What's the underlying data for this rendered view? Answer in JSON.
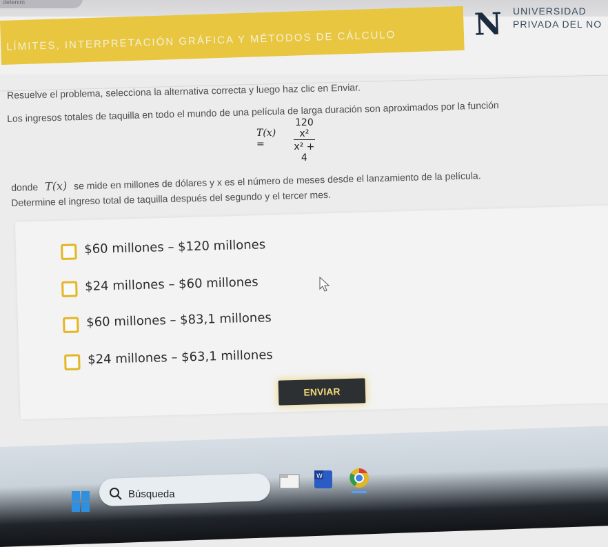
{
  "top_tab": {
    "label": "detenim"
  },
  "header": {
    "title": "LÍMITES, INTERPRETACIÓN GRÁFICA Y MÉTODOS DE CÁLCULO",
    "logo_letter": "N",
    "logo_line1": "UNIVERSIDAD",
    "logo_line2": "PRIVADA DEL NO"
  },
  "problem": {
    "instruction": "Resuelve el problema, selecciona la alternativa correcta y luego haz clic en Enviar.",
    "intro": "Los ingresos totales de taquilla en todo el mundo de una película de larga duración son aproximados por la función",
    "formula_lhs": "T(x) =",
    "formula_num": "120 x²",
    "formula_den": "x² + 4",
    "where_prefix": "donde",
    "where_var": "T(x)",
    "where_suffix": "se mide en millones de dólares y x es el número de meses desde el lanzamiento de la película.",
    "question": "Determine el ingreso total de taquilla después del segundo y el tercer mes."
  },
  "options": [
    {
      "label": "$60 millones  – $120 millones"
    },
    {
      "label": "$24 millones  – $60 millones"
    },
    {
      "label": "$60 millones  – $83,1 millones"
    },
    {
      "label": "$24 millones  – $63,1 millones"
    }
  ],
  "submit_label": "ENVIAR",
  "taskbar": {
    "search_text": "Búsqueda"
  },
  "colors": {
    "accent_yellow": "#e9c63f",
    "checkbox_border": "#e3b623",
    "button_bg": "#2d3033",
    "button_text": "#f0d878"
  }
}
